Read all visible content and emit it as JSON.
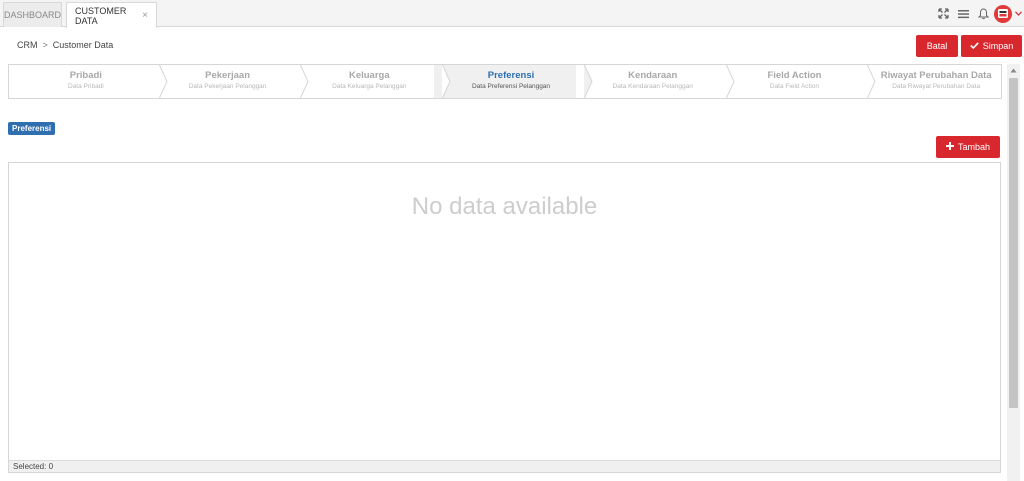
{
  "tabs": {
    "dashboard": "DASHBOARD",
    "customer_data": "CUSTOMER DATA",
    "close_glyph": "×"
  },
  "breadcrumb": {
    "root": "CRM",
    "separator": ">",
    "current": "Customer Data"
  },
  "actions": {
    "batal": "Batal",
    "simpan": "Simpan",
    "tambah": "Tambah"
  },
  "wizard": {
    "steps": [
      {
        "title": "Pribadi",
        "subtitle": "Data Pribadi"
      },
      {
        "title": "Pekerjaan",
        "subtitle": "Data Pekerjaan Pelanggan"
      },
      {
        "title": "Keluarga",
        "subtitle": "Data Keluarga Pelanggan"
      },
      {
        "title": "Preferensi",
        "subtitle": "Data Preferensi Pelanggan"
      },
      {
        "title": "Kendaraan",
        "subtitle": "Data Kendaraan Pelanggan"
      },
      {
        "title": "Field Action",
        "subtitle": "Data Field Action"
      },
      {
        "title": "Riwayat Perubahan Data",
        "subtitle": "Data Riwayat Perubahan Data"
      }
    ],
    "active_index": 3
  },
  "section": {
    "badge": "Preferensi"
  },
  "grid": {
    "empty_text": "No data available",
    "footer": "Selected: 0"
  },
  "icons": {
    "fullscreen": "expand-icon",
    "menu": "hamburger-menu-icon",
    "notifications": "bell-icon",
    "user": "avatar-icon",
    "user_menu": "chevron-down-icon"
  },
  "colors": {
    "accent_red": "#d9272e",
    "active_blue": "#2d6fb0",
    "badge_blue": "#2f6fb0"
  }
}
